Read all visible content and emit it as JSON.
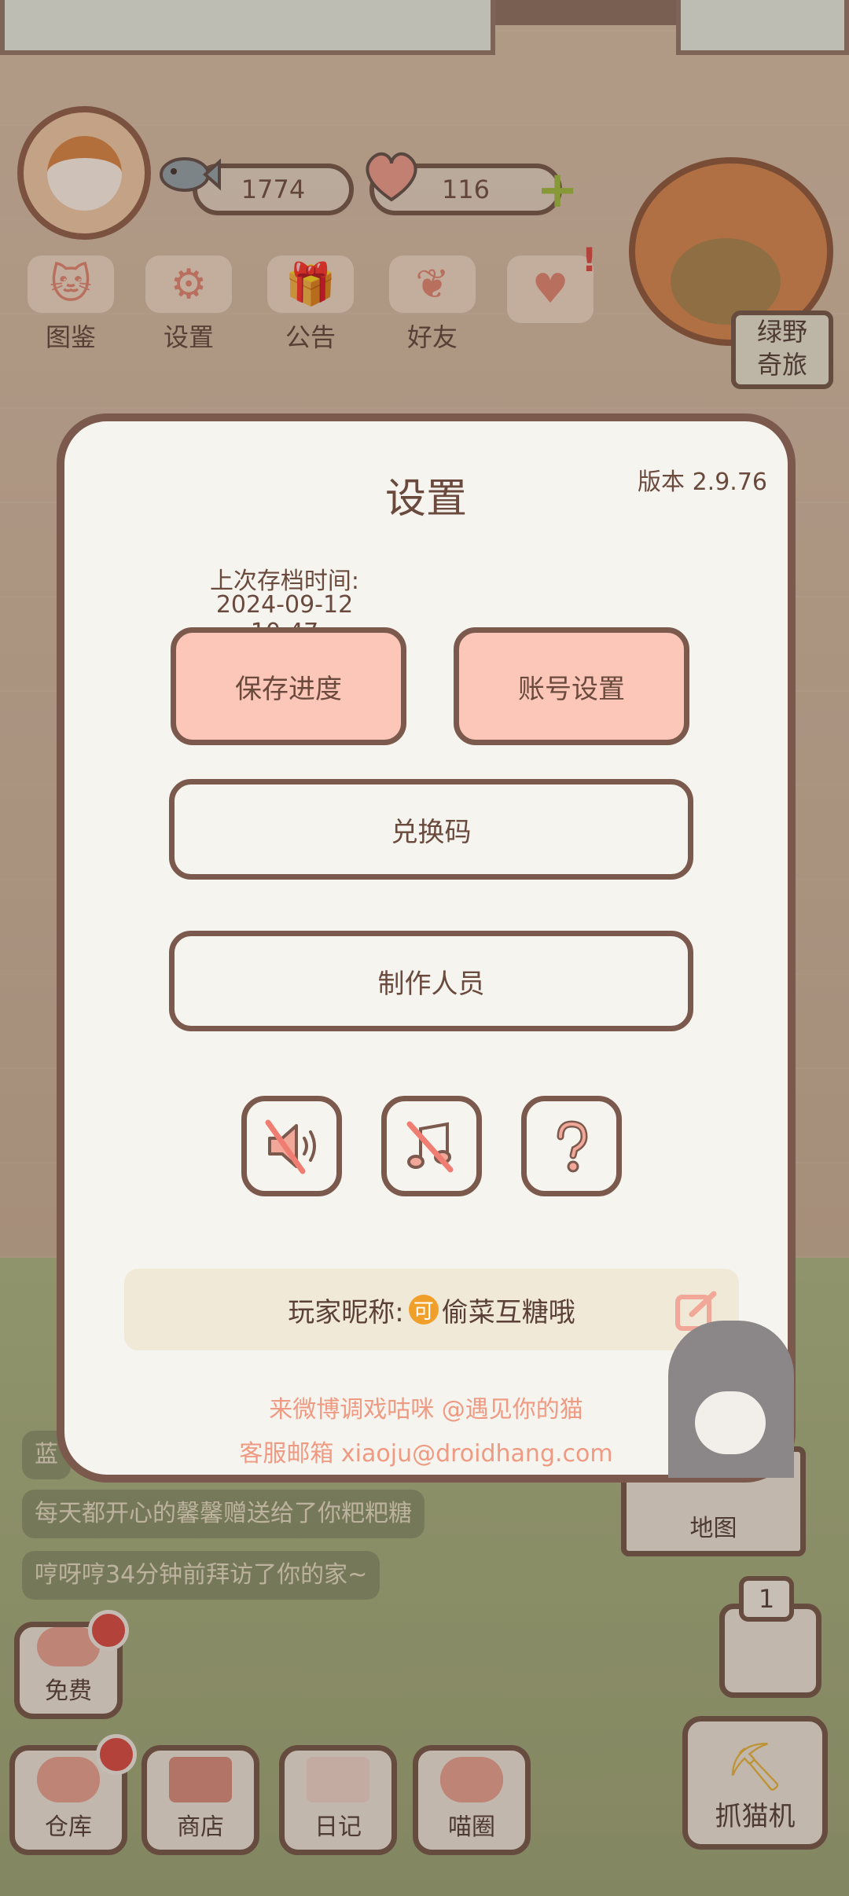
{
  "hud": {
    "coins": "1774",
    "hearts": "116"
  },
  "top_menu": [
    {
      "label": "图鉴"
    },
    {
      "label": "设置"
    },
    {
      "label": "公告"
    },
    {
      "label": "好友"
    }
  ],
  "trip_sign": "绿野\n奇旅",
  "chat": [
    "蓝",
    "每天都开心的馨馨赠送给了你粑粑糖",
    "哼呀哼34分钟前拜访了你的家~"
  ],
  "bottom_nav": {
    "free": "免费",
    "warehouse": "仓库",
    "shop": "商店",
    "diary": "日记",
    "cat_circle": "喵圈",
    "claw_machine": "抓猫机",
    "map": "地图",
    "elevator_floor": "1"
  },
  "dialog": {
    "title": "设置",
    "version": "版本 2.9.76",
    "save_time_label": "上次存档时间:",
    "save_time_value": "2024-09-12 10:47",
    "save_button": "保存进度",
    "account_button": "账号设置",
    "redeem_button": "兑换码",
    "credits_button": "制作人员",
    "sound_icon": "sound-muted-icon",
    "music_icon": "music-muted-icon",
    "help_icon": "question-icon",
    "nickname_label": "玩家昵称:",
    "nickname_badge": "可",
    "nickname": "偷菜互糖哦",
    "weibo_line": "来微博调戏咕咪 @遇见你的猫",
    "mail_line": "客服邮箱 xiaoju@droidhang.com"
  },
  "colors": {
    "pink_button": "#fcc7b8",
    "border_brown": "#7b5a4d",
    "footer_text": "#ef9a82"
  }
}
